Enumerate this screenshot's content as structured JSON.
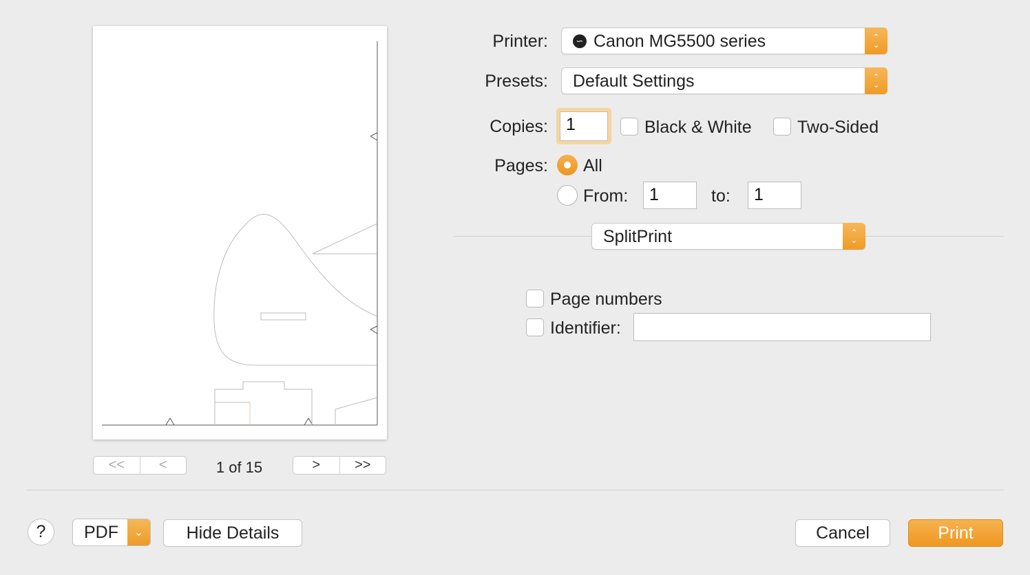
{
  "preview": {
    "page_indicator": "1 of 15",
    "first_label": "<<",
    "prev_label": "<",
    "next_label": ">",
    "last_label": ">>"
  },
  "form": {
    "printer_label": "Printer:",
    "printer_value": "Canon MG5500 series",
    "printer_icon": "printer-status-icon",
    "presets_label": "Presets:",
    "presets_value": "Default Settings",
    "copies_label": "Copies:",
    "copies_value": "1",
    "black_white_label": "Black & White",
    "black_white_checked": false,
    "two_sided_label": "Two-Sided",
    "two_sided_checked": false,
    "pages_label": "Pages:",
    "pages_all_label": "All",
    "pages_all_selected": true,
    "pages_from_label": "From:",
    "pages_from_value": "1",
    "pages_to_label": "to:",
    "pages_to_value": "1"
  },
  "section_popup": {
    "value": "SplitPrint"
  },
  "splitprint": {
    "page_numbers_label": "Page numbers",
    "page_numbers_checked": false,
    "identifier_label": "Identifier:",
    "identifier_checked": false,
    "identifier_value": ""
  },
  "footer": {
    "help_label": "?",
    "pdf_label": "PDF",
    "hide_details_label": "Hide Details",
    "cancel_label": "Cancel",
    "print_label": "Print"
  },
  "colors": {
    "accent": "#ef9b25",
    "background": "#ececec"
  }
}
